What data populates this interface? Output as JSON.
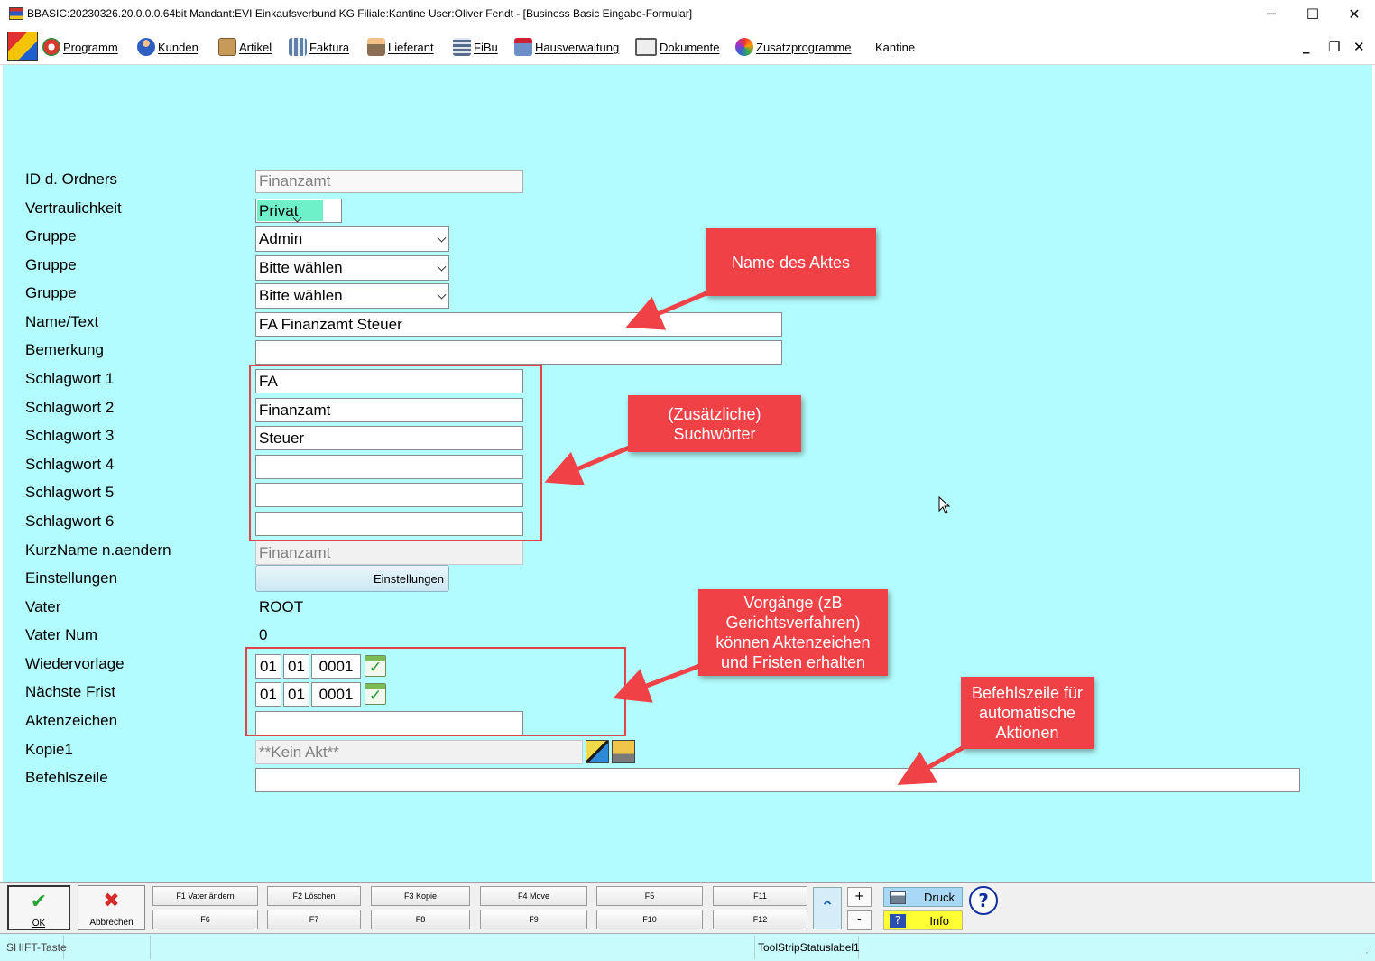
{
  "window": {
    "title": "BBASIC:20230326.20.0.0.0.64bit Mandant:EVI Einkaufsverbund KG Filiale:Kantine User:Oliver Fendt - [Business Basic Eingabe-Formular]",
    "minimize": "─",
    "maximize": "☐",
    "close": "✕"
  },
  "menu": {
    "items": [
      {
        "label": "Programm",
        "icon": "programm-icon",
        "color": "#d63a2f"
      },
      {
        "label": "Kunden",
        "icon": "kunden-icon",
        "color": "#2e5fc1"
      },
      {
        "label": "Artikel",
        "icon": "artikel-icon",
        "color": "#b88a4a"
      },
      {
        "label": "Faktura",
        "icon": "faktura-icon",
        "color": "#5d7fa8"
      },
      {
        "label": "Lieferant",
        "icon": "lieferant-icon",
        "color": "#8a6f52"
      },
      {
        "label": "FiBu",
        "icon": "fibu-icon",
        "color": "#556b8a"
      },
      {
        "label": "Hausverwaltung",
        "icon": "hausverwaltung-icon",
        "color": "#6a8fc9"
      },
      {
        "label": "Dokumente",
        "icon": "dokumente-icon",
        "color": "#5a5a5a"
      },
      {
        "label": "Zusatzprogramme",
        "icon": "zusatzprogramme-icon",
        "color": "#3aa05a"
      }
    ],
    "kantine": "Kantine",
    "mdi_min": "_",
    "mdi_restore": "❐",
    "mdi_close": "✕"
  },
  "form": {
    "labels": {
      "id_ordner": "ID d. Ordners",
      "vertraulichkeit": "Vertraulichkeit",
      "gruppe1": "Gruppe",
      "gruppe2": "Gruppe",
      "gruppe3": "Gruppe",
      "name_text": "Name/Text",
      "bemerkung": "Bemerkung",
      "schlagwort1": "Schlagwort 1",
      "schlagwort2": "Schlagwort 2",
      "schlagwort3": "Schlagwort 3",
      "schlagwort4": "Schlagwort 4",
      "schlagwort5": "Schlagwort 5",
      "schlagwort6": "Schlagwort 6",
      "kurzname": "KurzName n.aendern",
      "einstellungen": "Einstellungen",
      "vater": "Vater",
      "vater_num": "Vater Num",
      "wiedervorlage": "Wiedervorlage",
      "naechste_frist": "Nächste Frist",
      "aktenzeichen": "Aktenzeichen",
      "kopie1": "Kopie1",
      "befehlszeile": "Befehlszeile"
    },
    "values": {
      "id_ordner": "Finanzamt",
      "vertraulichkeit": "Privat",
      "gruppe1": "Admin",
      "gruppe2": "Bitte wählen",
      "gruppe3": "Bitte wählen",
      "name_text": "FA Finanzamt Steuer",
      "bemerkung": "",
      "schlagwort1": "FA",
      "schlagwort2": "Finanzamt",
      "schlagwort3": "Steuer",
      "schlagwort4": "",
      "schlagwort5": "",
      "schlagwort6": "",
      "kurzname": "Finanzamt",
      "einstellungen_button": "Einstellungen",
      "vater": "ROOT",
      "vater_num": "0",
      "wiedervorlage": {
        "day": "01",
        "month": "01",
        "year": "0001"
      },
      "naechste_frist": {
        "day": "01",
        "month": "01",
        "year": "0001"
      },
      "aktenzeichen": "",
      "kopie1": "**Kein Akt**",
      "befehlszeile": ""
    }
  },
  "annotations": {
    "name_des_aktes": "Name des Aktes",
    "suchwoerter_line1": "(Zusätzliche)",
    "suchwoerter_line2": "Suchwörter",
    "vorgaenge_line1": "Vorgänge (zB",
    "vorgaenge_line2": "Gerichtsverfahren)",
    "vorgaenge_line3": "können Aktenzeichen",
    "vorgaenge_line4": "und Fristen erhalten",
    "befehlszeile_line1": "Befehlszeile für",
    "befehlszeile_line2": "automatische",
    "befehlszeile_line3": "Aktionen",
    "color": "#f04246"
  },
  "footer": {
    "ok": "OK",
    "abbrechen": "Abbrechen",
    "f1": "F1 Vater ändern",
    "f2": "F2 Löschen",
    "f3": "F3 Kopie",
    "f4": "F4 Move",
    "f5": "F5",
    "f11": "F11",
    "f6": "F6",
    "f7": "F7",
    "f8": "F8",
    "f9": "F9",
    "f10": "F10",
    "f12": "F12",
    "plus": "+",
    "minus": "-",
    "druck": "Druck",
    "info": "Info",
    "help": "?"
  },
  "status": {
    "shift": "SHIFT-Taste",
    "cell2": "",
    "cell3": "",
    "label1": "ToolStripStatuslabel1"
  },
  "colors": {
    "form_bg": "#b3fcfd",
    "status_bg": "#c8fbfb",
    "privat_highlight": "#6ef0c8",
    "info_bg": "#ffff33",
    "druck_bg": "#a8d8f4"
  }
}
